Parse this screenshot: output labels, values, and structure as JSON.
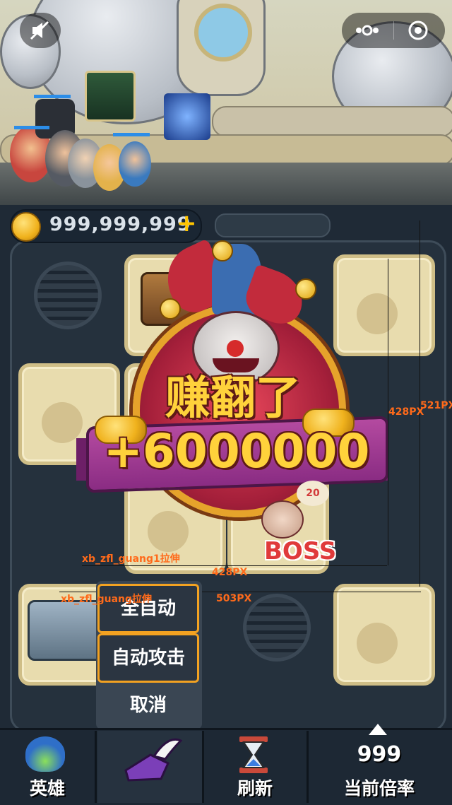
{
  "hud": {
    "coins": "999,999,999",
    "add_symbol": "+"
  },
  "reward": {
    "title": "赚翻了",
    "amount": "+6000000",
    "level_badge": "20"
  },
  "boss_label": "BOSS",
  "dev_annotations": {
    "width_428_a": "428PX",
    "width_428_b": "428PX",
    "height_521": "521PX",
    "width_503": "503PX",
    "stretch_label_1": "xb_zfl_guang1拉伸",
    "stretch_label_2": "xb_zfl_guang拉伸"
  },
  "popup_menu": {
    "items": [
      "全自动",
      "自动攻击",
      "取消"
    ]
  },
  "bottom_nav": {
    "heroes": "英雄",
    "refresh": "刷新",
    "multiplier_value": "999",
    "multiplier_label": "当前倍率"
  },
  "colors": {
    "accent_gold": "#ffd23b",
    "menu_highlight": "#f3a221",
    "annotation": "#ff6a1a"
  },
  "icons": [
    "mute-icon",
    "more-dots-icon",
    "target-icon",
    "coin-icon",
    "plus-icon",
    "boots-icon",
    "hourglass-icon",
    "hero-helmet-icon",
    "arrow-up-icon"
  ]
}
